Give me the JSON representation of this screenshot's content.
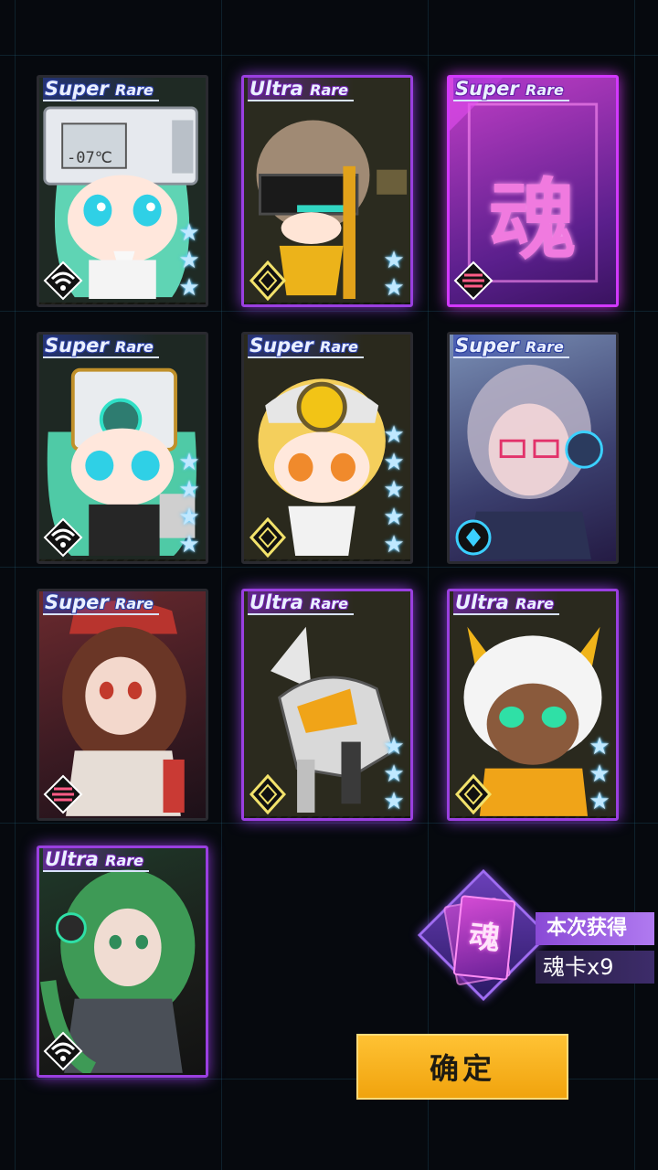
{
  "cards": [
    {
      "rarity_a": "Super",
      "rarity_b": "Rare",
      "tier": "super",
      "stars": 3,
      "class": "signal"
    },
    {
      "rarity_a": "Ultra",
      "rarity_b": "Rare",
      "tier": "ultra",
      "stars": 2,
      "class": "diamond"
    },
    {
      "rarity_a": "Super",
      "rarity_b": "Rare",
      "tier": "soul",
      "stars": 0,
      "class": "soul",
      "glyph": "魂"
    },
    {
      "rarity_a": "Super",
      "rarity_b": "Rare",
      "tier": "super",
      "stars": 4,
      "class": "signal"
    },
    {
      "rarity_a": "Super",
      "rarity_b": "Rare",
      "tier": "super",
      "stars": 5,
      "class": "diamond"
    },
    {
      "rarity_a": "Super",
      "rarity_b": "Rare",
      "tier": "super",
      "stars": 0,
      "class": "ring"
    },
    {
      "rarity_a": "Super",
      "rarity_b": "Rare",
      "tier": "super",
      "stars": 0,
      "class": "soul"
    },
    {
      "rarity_a": "Ultra",
      "rarity_b": "Rare",
      "tier": "ultra",
      "stars": 3,
      "class": "diamond"
    },
    {
      "rarity_a": "Ultra",
      "rarity_b": "Rare",
      "tier": "ultra",
      "stars": 3,
      "class": "diamond"
    },
    {
      "rarity_a": "Ultra",
      "rarity_b": "Rare",
      "tier": "ultra",
      "stars": 0,
      "class": "signal"
    }
  ],
  "thermo_readout": "-07℃",
  "reward": {
    "icon_glyph": "魂",
    "label": "本次获得",
    "value": "魂卡x9"
  },
  "confirm_label": "确定",
  "colors": {
    "ultra_glow": "#9a3fe0",
    "super_banner": "#2a3ea0",
    "star": "#bfe8ff",
    "button": "#f0a20c"
  }
}
